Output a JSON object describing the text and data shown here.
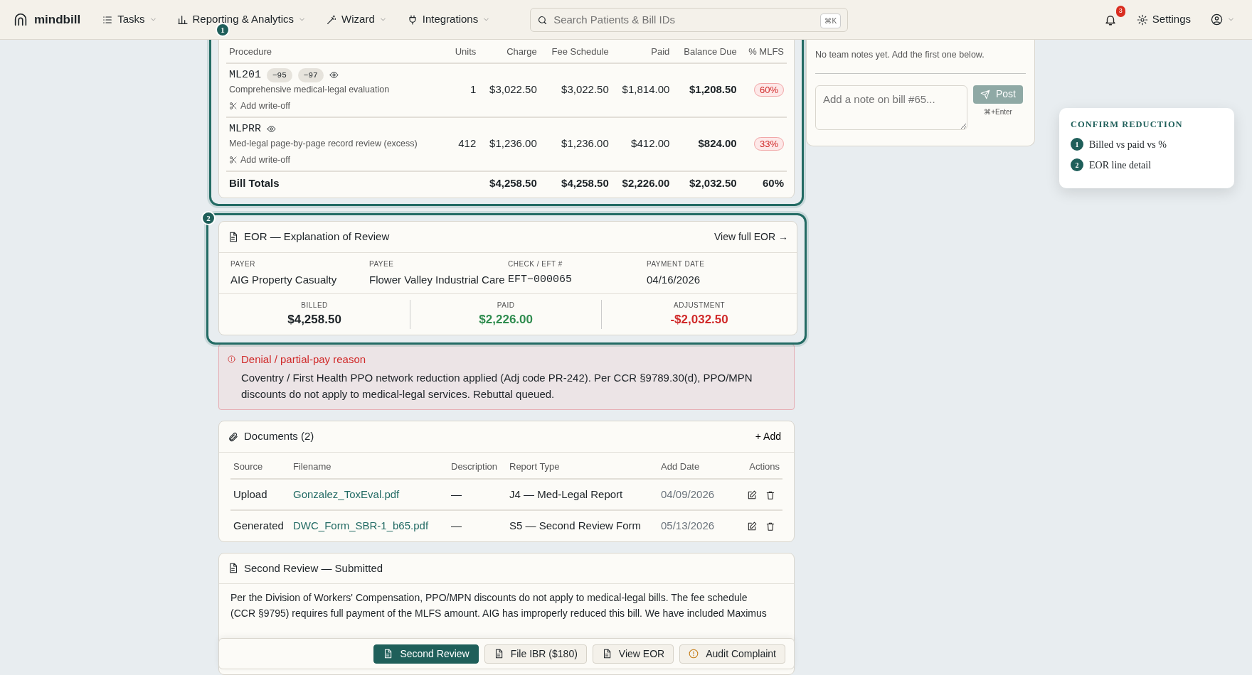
{
  "nav": {
    "brand": "mindbill",
    "items": [
      {
        "label": "Tasks",
        "has_menu": true
      },
      {
        "label": "Reporting & Analytics",
        "has_menu": true
      },
      {
        "label": "Wizard",
        "has_menu": true
      },
      {
        "label": "Integrations",
        "has_menu": true
      }
    ],
    "search": {
      "placeholder": "Search Patients & Bill IDs",
      "shortcut": "⌘K"
    },
    "notifications": {
      "count": "3"
    },
    "settings": "Settings",
    "account": {
      "has_menu": true
    }
  },
  "procedures": {
    "step": "1",
    "highlighted": true,
    "columns": [
      "Procedure",
      "Units",
      "Charge",
      "Fee Schedule",
      "Paid",
      "Balance Due",
      "% MLFS"
    ],
    "rows": [
      {
        "code": "ML201",
        "modifiers": [
          "−95",
          "−97"
        ],
        "description": "Comprehensive medical-legal evaluation",
        "writeoff": "Add write-off",
        "units": "1",
        "charge": "$3,022.50",
        "fee_schedule": "$3,022.50",
        "paid": "$1,814.00",
        "balance_due": "$1,208.50",
        "mlfs": "60%"
      },
      {
        "code": "MLPRR",
        "modifiers": [],
        "description": "Med-legal page-by-page record review (excess)",
        "writeoff": "Add write-off",
        "units": "412",
        "charge": "$1,236.00",
        "fee_schedule": "$1,236.00",
        "paid": "$412.00",
        "balance_due": "$824.00",
        "mlfs": "33%"
      }
    ],
    "totals": {
      "label": "Bill Totals",
      "charge": "$4,258.50",
      "fee_schedule": "$4,258.50",
      "paid": "$2,226.00",
      "balance_due": "$2,032.50",
      "mlfs": "60%"
    }
  },
  "eor": {
    "step": "2",
    "highlighted": true,
    "title": "EOR — Explanation of Review",
    "link": "View full EOR →",
    "fields": [
      {
        "label": "PAYER",
        "value": "AIG Property Casualty",
        "mono": false
      },
      {
        "label": "PAYEE",
        "value": "Flower Valley Industrial Care",
        "mono": false
      },
      {
        "label": "CHECK / EFT #",
        "value": "EFT−000065",
        "mono": true
      },
      {
        "label": "PAYMENT DATE",
        "value": "04/16/2026",
        "mono": false
      }
    ],
    "summary": [
      {
        "label": "BILLED",
        "value": "$4,258.50",
        "kind": "neutral"
      },
      {
        "label": "PAID",
        "value": "$2,226.00",
        "kind": "positive"
      },
      {
        "label": "ADJUSTMENT",
        "value": "-$2,032.50",
        "kind": "negative"
      }
    ]
  },
  "denial": {
    "title": "Denial / partial-pay reason",
    "text": "Coventry / First Health PPO network reduction applied (Adj code PR-242). Per CCR §9789.30(d), PPO/MPN discounts do not apply to medical-legal services. Rebuttal queued."
  },
  "documents": {
    "title": "Documents (2)",
    "add": "+ Add",
    "columns": [
      "Source",
      "Filename",
      "Description",
      "Report Type",
      "Add Date",
      "Actions"
    ],
    "rows": [
      {
        "source": "Upload",
        "filename": "Gonzalez_ToxEval.pdf",
        "description": "—",
        "report_type": "J4 — Med-Legal Report",
        "add_date": "04/09/2026"
      },
      {
        "source": "Generated",
        "filename": "DWC_Form_SBR-1_b65.pdf",
        "description": "—",
        "report_type": "S5 — Second Review Form",
        "add_date": "05/13/2026"
      }
    ]
  },
  "second_review": {
    "title": "Second Review — Submitted",
    "lines": [
      "Per the Division of Workers' Compensation, PPO/MPN discounts do not apply to medical-legal bills. The fee schedule",
      "(CCR §9795) requires full payment of the MLFS amount. AIG has improperly reduced this bill. We have included Maximus"
    ]
  },
  "actions": [
    {
      "label": "Second Review",
      "kind": "primary"
    },
    {
      "label": "File IBR ($180)",
      "kind": "secondary"
    },
    {
      "label": "View EOR",
      "kind": "secondary"
    },
    {
      "label": "Audit Complaint",
      "kind": "warning"
    }
  ],
  "notes": {
    "empty": "No team notes yet. Add the first one below.",
    "placeholder": "Add a note on bill #65...",
    "post": "Post",
    "hint": "⌘+Enter",
    "post_disabled": true
  },
  "confirm": {
    "title": "CONFIRM REDUCTION",
    "steps": [
      {
        "number": "1",
        "label": "Billed vs paid vs %"
      },
      {
        "number": "2",
        "label": "EOR line detail"
      }
    ]
  }
}
